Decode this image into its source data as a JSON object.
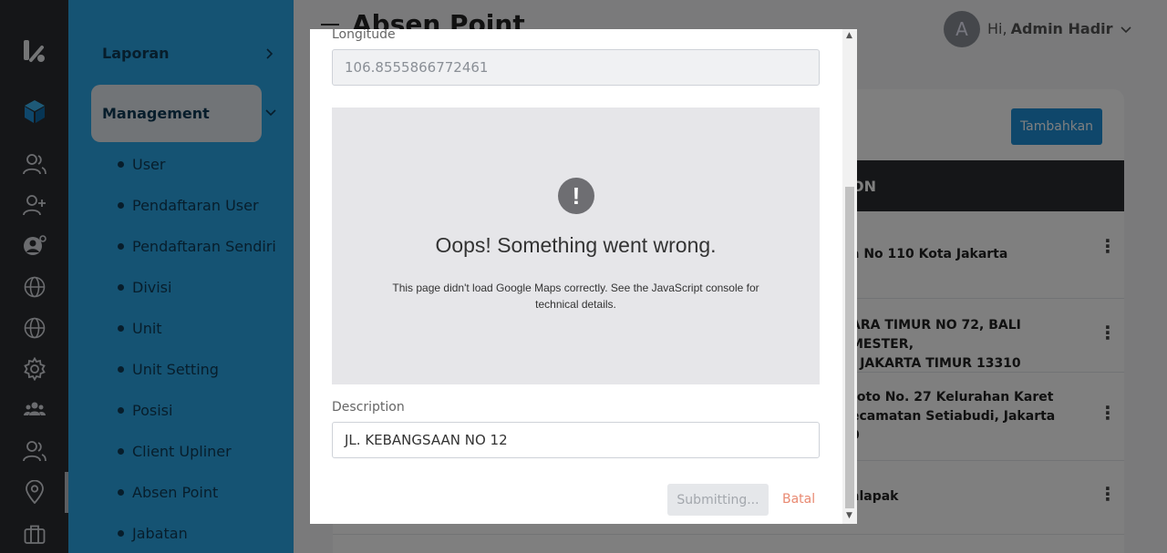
{
  "rail": {
    "icons": [
      "brand-logo-icon",
      "cube-icon",
      "users-icon",
      "user-plus-icon",
      "user-gear-icon",
      "globe-icon",
      "globe-icon",
      "settings-icon",
      "team-icon",
      "users-icon",
      "location-pin-icon",
      "briefcase-icon"
    ]
  },
  "sidebar": {
    "laporan": "Laporan",
    "management": "Management",
    "items": [
      "User",
      "Pendaftaran User",
      "Pendaftaran Sendiri",
      "Divisi",
      "Unit",
      "Unit Setting",
      "Posisi",
      "Client Upliner",
      "Absen Point",
      "Jabatan"
    ]
  },
  "header": {
    "title": "Absen Point",
    "avatar_initial": "A",
    "greeting": "Hi,",
    "user_name": "Admin Hadir"
  },
  "main": {
    "add_button": "Tambahkan",
    "table_header_partial": "ON",
    "rows": [
      {
        "address_lines": [
          "a No 110 Kota Jakarta"
        ]
      },
      {
        "address_lines": [
          "ARA TIMUR NO 72, BALI MESTER,",
          ", JAKARTA TIMUR 13310"
        ]
      },
      {
        "address_lines": [
          "roto No. 27 Kelurahan Karet",
          "ecamatan Setiabudi, Jakarta",
          "0"
        ]
      },
      {
        "address_lines": [
          "alapak"
        ]
      }
    ]
  },
  "modal": {
    "longitude_label": "Longitude",
    "longitude_value": "106.8555866772461",
    "map_error_title": "Oops! Something went wrong.",
    "map_error_detail": "This page didn't load Google Maps correctly. See the JavaScript console for technical details.",
    "description_label": "Description",
    "description_value": "JL. KEBANGSAAN NO 12",
    "submit_label": "Submitting...",
    "cancel_label": "Batal"
  },
  "colors": {
    "sidebar_blue": "#2aa7e6",
    "rail_dark": "#2a2d31",
    "primary_button": "#1f8fd6",
    "cancel_text": "#e98a72"
  }
}
